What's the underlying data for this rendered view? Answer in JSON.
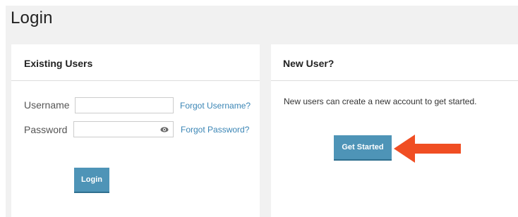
{
  "page": {
    "title": "Login"
  },
  "existing_users": {
    "heading": "Existing Users",
    "username": {
      "label": "Username",
      "value": "",
      "placeholder": "",
      "forgot_link": "Forgot Username?"
    },
    "password": {
      "label": "Password",
      "value": "",
      "placeholder": "",
      "forgot_link": "Forgot Password?"
    },
    "login_button": "Login"
  },
  "new_user": {
    "heading": "New User?",
    "description": "New users can create a new account to get started.",
    "get_started_button": "Get Started"
  },
  "colors": {
    "button": "#4e94b7",
    "link": "#3a85b5",
    "arrow": "#f04e23",
    "background": "#f1f1f1"
  },
  "icons": {
    "password_toggle": "eye-icon",
    "annotation": "arrow-left-icon"
  }
}
